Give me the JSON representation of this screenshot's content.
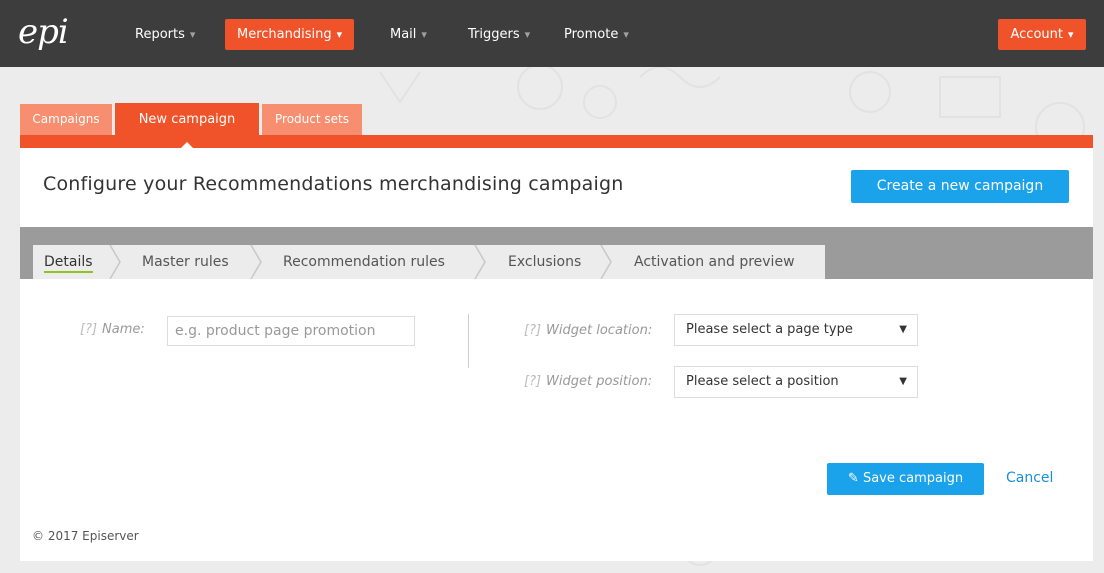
{
  "navbar": {
    "logo": "epi",
    "items": [
      {
        "label": "Reports",
        "caret": "▾"
      },
      {
        "label": "Merchandising",
        "caret": "▾"
      },
      {
        "label": "Mail",
        "caret": "▾"
      },
      {
        "label": "Triggers",
        "caret": "▾"
      },
      {
        "label": "Promote",
        "caret": "▾"
      }
    ],
    "account": {
      "label": "Account",
      "caret": "▾"
    }
  },
  "section_tabs": [
    "Campaigns",
    "New campaign",
    "Product sets"
  ],
  "page": {
    "title": "Configure your Recommendations merchandising campaign",
    "create_button": "Create a new campaign"
  },
  "steps": [
    "Details",
    "Master rules",
    "Recommendation rules",
    "Exclusions",
    "Activation and preview"
  ],
  "form": {
    "name": {
      "help": "[?]",
      "label": "Name:",
      "placeholder": "e.g. product page promotion"
    },
    "widget_location": {
      "help": "[?]",
      "label": "Widget location:",
      "value": "Please select a page type",
      "arrow": "▼"
    },
    "widget_position": {
      "help": "[?]",
      "label": "Widget position:",
      "value": "Please select a position",
      "arrow": "▼"
    }
  },
  "actions": {
    "save_icon": "edit-icon",
    "save_glyph": "✎",
    "save": "Save campaign",
    "cancel": "Cancel"
  },
  "footer": {
    "copyright": "© 2017 Episerver"
  },
  "colors": {
    "navbar": "#3d3d3d",
    "accent_orange": "#f0532a",
    "tab_inactive": "#f68e6f",
    "primary_blue": "#1aa2eb",
    "step_underline": "#8fc31f"
  }
}
